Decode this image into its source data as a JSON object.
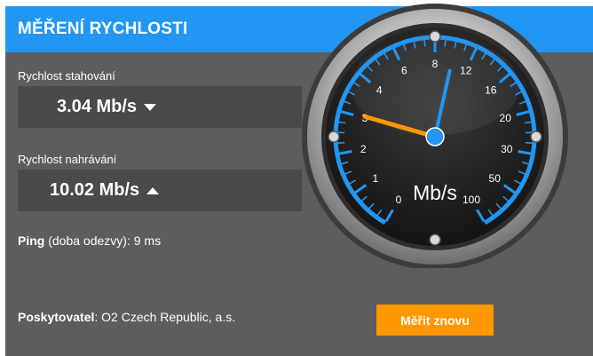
{
  "header": {
    "title": "MĚŘENÍ RYCHLOSTI"
  },
  "download": {
    "label": "Rychlost stahování",
    "value": "3.04 Mb/s"
  },
  "upload": {
    "label": "Rychlost nahrávání",
    "value": "10.02 Mb/s"
  },
  "ping": {
    "label": "Ping",
    "detail": " (doba odezvy): 9 ms"
  },
  "provider": {
    "label": "Poskytovatel",
    "value": ": O2 Czech Republic, a.s."
  },
  "retest_button": {
    "label": "Měřit znovu"
  },
  "gauge": {
    "unit": "Mb/s",
    "scale_labels": [
      "0",
      "1",
      "2",
      "3",
      "4",
      "6",
      "8",
      "12",
      "16",
      "20",
      "30",
      "50",
      "100"
    ],
    "download_value": 3.04,
    "upload_value": 10.02,
    "colors": {
      "accent": "#2196f3",
      "download_needle": "#ff9800",
      "upload_needle": "#2196f3",
      "button": "#ff9800"
    }
  }
}
